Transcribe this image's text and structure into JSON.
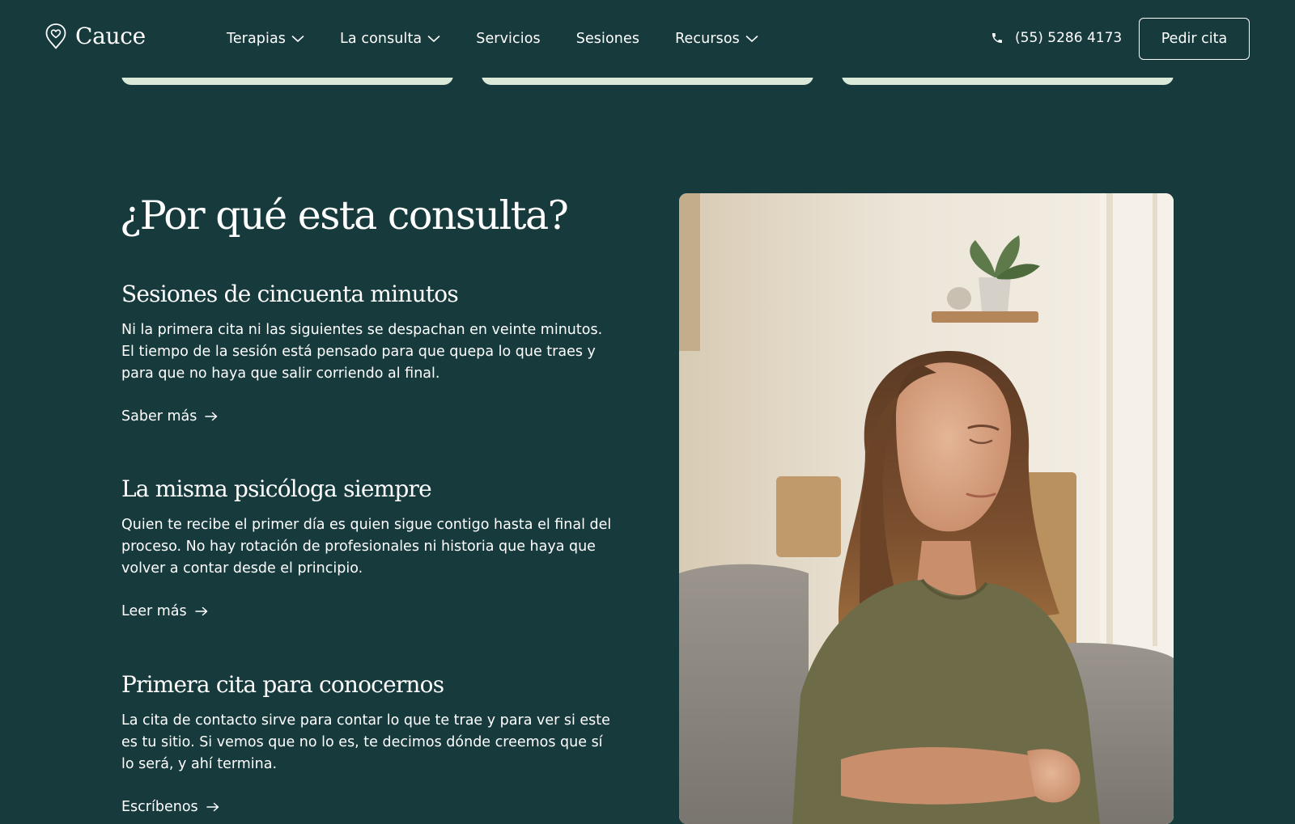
{
  "brand": {
    "name": "Cauce",
    "logo_icon": "location-heart-icon"
  },
  "nav": {
    "items": [
      {
        "label": "Terapias",
        "dropdown": true
      },
      {
        "label": "La consulta",
        "dropdown": true
      },
      {
        "label": "Servicios",
        "dropdown": false
      },
      {
        "label": "Sesiones",
        "dropdown": false
      },
      {
        "label": "Recursos",
        "dropdown": true
      }
    ]
  },
  "contact": {
    "phone": "(55) 5286 4173",
    "phone_icon": "phone-icon"
  },
  "cta": {
    "label": "Pedir cita"
  },
  "section": {
    "title": "¿Por qué esta consulta?",
    "features": [
      {
        "title": "Sesiones de cincuenta minutos",
        "text": "Ni la primera cita ni las siguientes se despachan en veinte minutos. El tiempo de la sesión está pensado para que quepa lo que traes y para que no haya que salir corriendo al final.",
        "link": "Saber más"
      },
      {
        "title": "La misma psicóloga siempre",
        "text": "Quien te recibe el primer día es quien sigue contigo hasta el final del proceso. No hay rotación de profesionales ni historia que haya que volver a contar desde el principio.",
        "link": "Leer más"
      },
      {
        "title": "Primera cita para conocernos",
        "text": "La cita de contacto sirve para contar lo que te trae y para ver si este es tu sitio. Si vemos que no lo es, te decimos dónde creemos que sí lo será, y ahí termina.",
        "link": "Escríbenos"
      }
    ]
  },
  "colors": {
    "background": "#173a3d",
    "text": "#ffffff",
    "card_edge": "#dbe9d8"
  }
}
